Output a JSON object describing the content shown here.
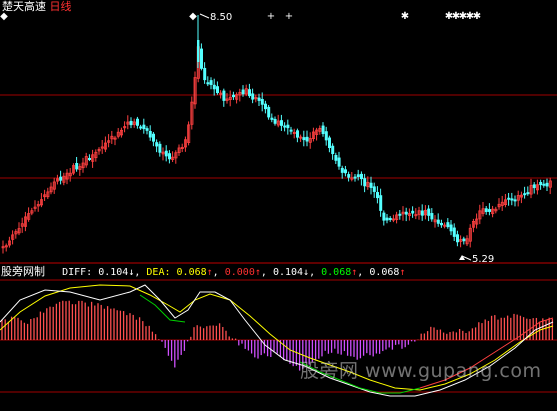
{
  "header": {
    "stock_name": "楚天高速",
    "period": "日线"
  },
  "price_panel": {
    "high_label": "8.50",
    "low_label": "5.29",
    "signal_marks": {
      "diamond": "◆",
      "cross": "+",
      "star": "✱"
    }
  },
  "indicator_panel": {
    "indicator_name": "股旁网制",
    "diff_label": "DIFF:",
    "diff_value": "0.104",
    "diff_arrow": "↓",
    "dea_label": "DEA:",
    "dea_value": "0.068",
    "dea_arrow": "↑",
    "extra_1": "0.000",
    "extra_1_arrow": "↑",
    "extra_2": "0.104",
    "extra_2_arrow": "↓",
    "extra_3": "0.068",
    "extra_3_arrow": "↑",
    "extra_4": "0.068",
    "extra_4_arrow": "↑"
  },
  "watermark": {
    "text": "股旁网 www.gupang.com"
  },
  "colors": {
    "background": "#000000",
    "up_candle": "#ff4040",
    "down_candle": "#54ffff",
    "grid": "#a00000",
    "diff_line": "#ffffff",
    "dea_line": "#ffff00",
    "green_line": "#00d000",
    "histogram_up": "#ff5050",
    "histogram_down": "#d050ff",
    "label_white": "#ffffff",
    "label_red": "#ff3030",
    "label_green": "#00ff00"
  }
}
